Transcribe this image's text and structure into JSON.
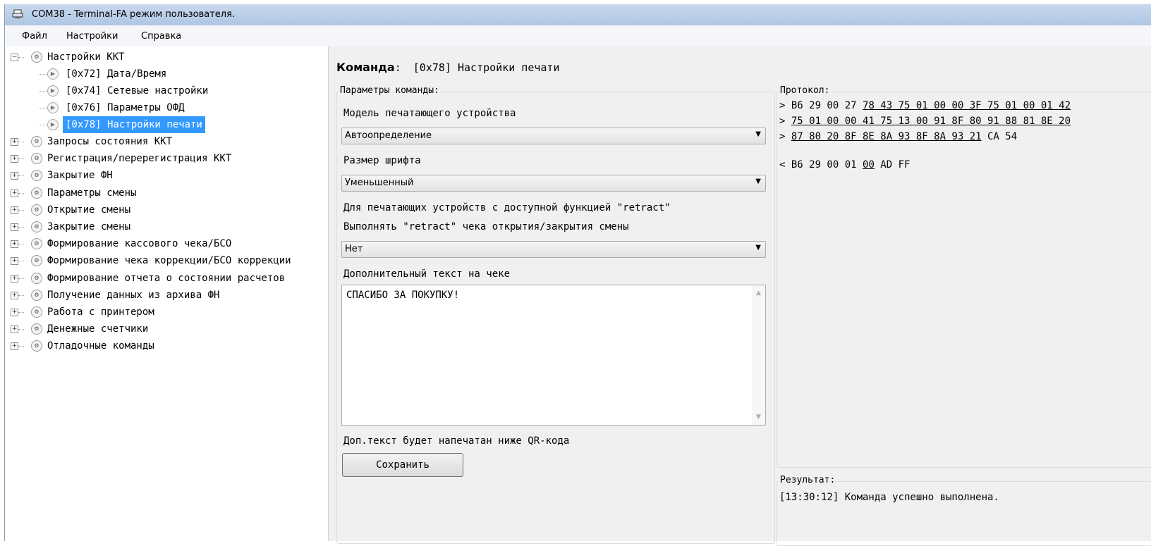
{
  "window": {
    "title": "COM38 - Terminal-FA режим пользователя."
  },
  "menu": {
    "items": [
      "Файл",
      "Настройки",
      "Справка"
    ]
  },
  "tree": {
    "root": {
      "label": "Настройки ККТ",
      "expander": "−"
    },
    "children": [
      {
        "label": "[0x72] Дата/Время"
      },
      {
        "label": "[0x74] Сетевые настройки"
      },
      {
        "label": "[0x76] Параметры ОФД"
      },
      {
        "label": "[0x78] Настройки печати"
      }
    ],
    "nodes": [
      "Запросы состояния ККТ",
      "Регистрация/перерегистрация ККТ",
      "Закрытие ФН",
      "Параметры смены",
      "Открытие смены",
      "Закрытие смены",
      "Формирование кассового чека/БСО",
      "Формирование чека коррекции/БСО коррекции",
      "Формирование отчета о состоянии расчетов",
      "Получение данных из архива ФН",
      "Работа с принтером",
      "Денежные счетчики",
      "Отладочные команды"
    ]
  },
  "command": {
    "label": "Команда",
    "colon": ":",
    "value": "[0x78] Настройки печати"
  },
  "params": {
    "title": "Параметры команды:",
    "printer_model_label": "Модель печатающего устройства",
    "printer_model_value": "Автоопределение",
    "font_size_label": "Размер шрифта",
    "font_size_value": "Уменьшенный",
    "retract_info": "Для печатающих устройств с доступной функцией \"retract\"",
    "retract_label": "Выполнять \"retract\" чека открытия/закрытия смены",
    "retract_value": "Нет",
    "extra_text_label": "Дополнительный текст на чеке",
    "extra_text_value": "СПАСИБО ЗА ПОКУПКУ!",
    "note": "Доп.текст будет напечатан ниже QR-кода",
    "save_button": "Сохранить"
  },
  "protocol": {
    "title": "Протокол:",
    "line1_prefix": "> B6 29 00 27 ",
    "line1_underlined": "78 43 75 01 00 00 3F 75 01 00 01 42",
    "line2_prefix": "> ",
    "line2_underlined": "75 01 00 00 41 75 13 00 91 8F 80 91 88 81 8E 20",
    "line3_prefix": "> ",
    "line3_underlined": "87 80 20 8F 8E 8A 93 8F 8A 93 21",
    "line3_suffix": " CA 54",
    "line4_prefix": "< B6 29 00 01 ",
    "line4_underlined": "00",
    "line4_suffix": " AD FF"
  },
  "result": {
    "title": "Результат:",
    "text": "[13:30:12] Команда успешно выполнена."
  }
}
